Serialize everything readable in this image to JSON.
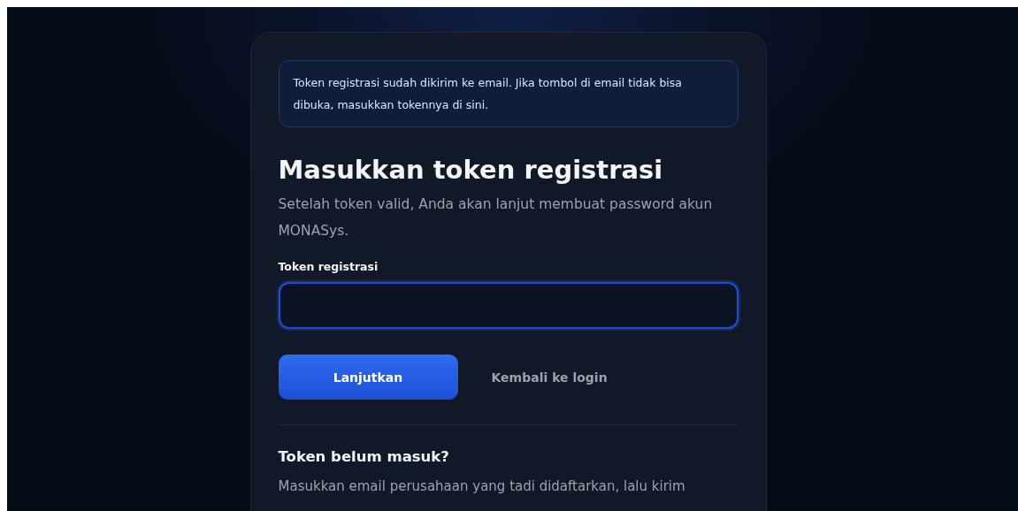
{
  "notice": "Token registrasi sudah dikirim ke email. Jika tombol di email tidak bisa dibuka, masukkan tokennya di sini.",
  "title": "Masukkan token registrasi",
  "subtitle": "Setelah token valid, Anda akan lanjut membuat password akun MONASys.",
  "token_field": {
    "label": "Token registrasi",
    "focused": true
  },
  "actions": [
    {
      "kind": "primary",
      "label": "Lanjutkan"
    },
    {
      "kind": "link",
      "label": "Kembali ke login"
    }
  ],
  "resend": {
    "title": "Token belum masuk?",
    "text": "Masukkan email perusahaan yang tadi didaftarkan, lalu kirim"
  }
}
